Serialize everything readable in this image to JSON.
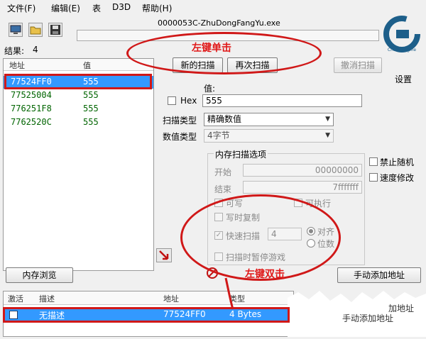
{
  "menu": [
    "文件(F)",
    "编辑(E)",
    "表",
    "D3D",
    "帮助(H)"
  ],
  "window_title": "0000053C-ZhuDongFangYu.exe",
  "toolbar_icons": [
    "computer-icon",
    "open-folder-icon",
    "save-icon"
  ],
  "results": {
    "label": "结果:",
    "count": "4"
  },
  "results_table": {
    "headers": [
      "地址",
      "值"
    ],
    "rows": [
      {
        "address": "77524FF0",
        "value": "555"
      },
      {
        "address": "77525004",
        "value": "555"
      },
      {
        "address": "776251F8",
        "value": "555"
      },
      {
        "address": "7762520C",
        "value": "555"
      }
    ]
  },
  "buttons": {
    "new_scan": "新的扫描",
    "next_scan": "再次扫描",
    "undo_scan": "撤消扫描",
    "memory_view": "内存浏览",
    "add_address": "手动添加地址"
  },
  "settings_label": "设置",
  "logo_text": "Cheat Engine",
  "value_section": {
    "label": "值:",
    "hex_label": "Hex",
    "value": "555"
  },
  "scan_type": {
    "label": "扫描类型",
    "selected": "精确数值"
  },
  "value_type": {
    "label": "数值类型",
    "selected": "4字节"
  },
  "memory_options": {
    "title": "内存扫描选项",
    "start_label": "开始",
    "start_value": "00000000",
    "stop_label": "结束",
    "stop_value": "7fffffff",
    "writable": "可写",
    "executable": "可执行",
    "copy_on_write": "写时复制",
    "fast_scan": "快速扫描",
    "fast_scan_value": "4",
    "alignment": "对齐",
    "last_digits": "位数",
    "pause_game": "扫描时暂停游戏"
  },
  "right_options": {
    "no_random": "禁止随机",
    "speedhack": "速度修改"
  },
  "address_list": {
    "headers": [
      "激活",
      "描述",
      "地址",
      "类型"
    ],
    "row": {
      "description": "无描述",
      "address": "77524FF0",
      "type": "4 Bytes"
    }
  },
  "annotations": {
    "left_click": "左键单击",
    "double_click": "左键双击",
    "torn_text_1": "加地址",
    "torn_text_2": "手动添加地址"
  },
  "colors": {
    "highlight": "#3399ff",
    "annotation_red": "#d01818",
    "result_green": "#006400"
  }
}
